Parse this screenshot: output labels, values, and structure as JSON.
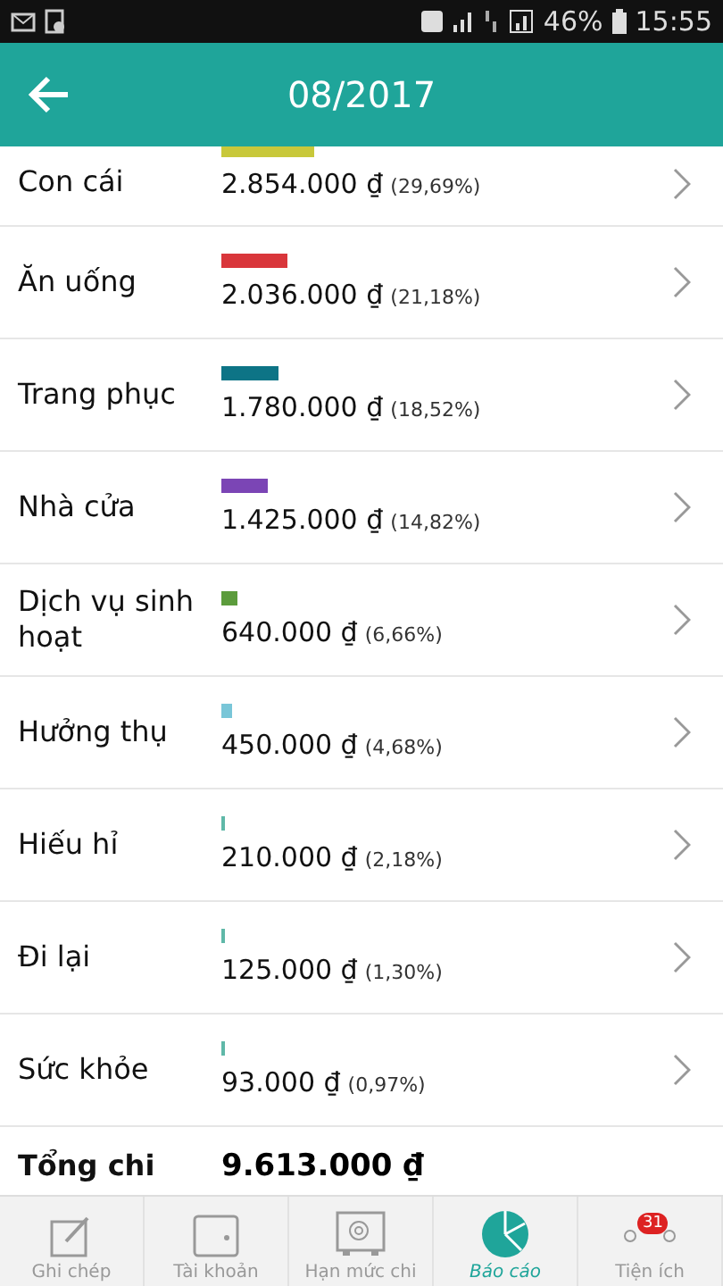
{
  "status_bar": {
    "battery": "46%",
    "time": "15:55"
  },
  "toolbar": {
    "title": "08/2017"
  },
  "categories": [
    {
      "name": "Con cái",
      "amount": "2.854.000 ₫",
      "percent": "(29,69%)",
      "color": "#c8c83a"
    },
    {
      "name": "Ăn uống",
      "amount": "2.036.000 ₫",
      "percent": "(21,18%)",
      "color": "#d9363b"
    },
    {
      "name": "Trang phục",
      "amount": "1.780.000 ₫",
      "percent": "(18,52%)",
      "color": "#0d7486"
    },
    {
      "name": "Nhà cửa",
      "amount": "1.425.000 ₫",
      "percent": "(14,82%)",
      "color": "#7b45b5"
    },
    {
      "name": "Dịch vụ sinh hoạt",
      "amount": "640.000 ₫",
      "percent": "(6,66%)",
      "color": "#5c9c3c"
    },
    {
      "name": "Hưởng thụ",
      "amount": "450.000 ₫",
      "percent": "(4,68%)",
      "color": "#79c6d8"
    },
    {
      "name": "Hiếu hỉ",
      "amount": "210.000 ₫",
      "percent": "(2,18%)",
      "color": "#5fb8a8"
    },
    {
      "name": "Đi lại",
      "amount": "125.000 ₫",
      "percent": "(1,30%)",
      "color": "#5fb8a8"
    },
    {
      "name": "Sức khỏe",
      "amount": "93.000 ₫",
      "percent": "(0,97%)",
      "color": "#5fb8a8"
    }
  ],
  "total": {
    "label": "Tổng chi",
    "amount": "9.613.000 ₫"
  },
  "nav": [
    {
      "kind": "note",
      "label": "Ghi chép",
      "selected": false
    },
    {
      "kind": "wallet",
      "label": "Tài khoản",
      "selected": false
    },
    {
      "kind": "safe",
      "label": "Hạn mức chi",
      "selected": false
    },
    {
      "kind": "report",
      "label": "Báo cáo",
      "selected": true
    },
    {
      "kind": "utility",
      "label": "Tiện ích",
      "selected": false,
      "badge": "31"
    }
  ]
}
